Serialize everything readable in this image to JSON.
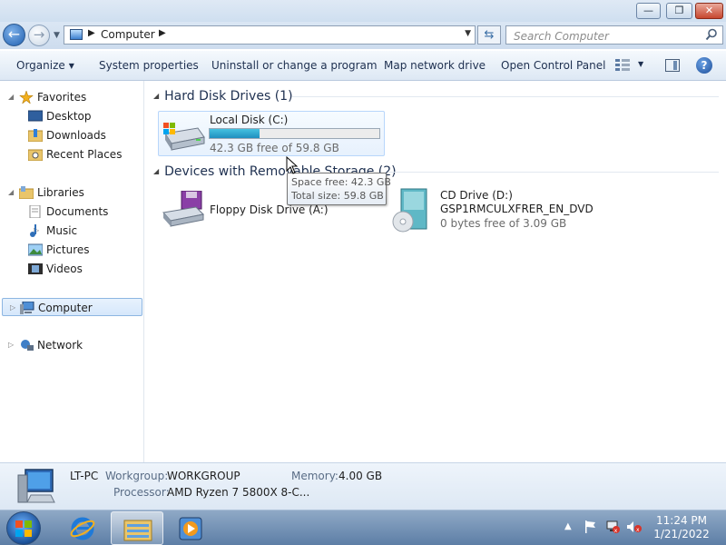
{
  "window": {
    "controls": {
      "minimize_glyph": "—",
      "maximize_glyph": "❐",
      "close_glyph": "✕"
    }
  },
  "address": {
    "path": "Computer",
    "search_placeholder": "Search Computer"
  },
  "commands": {
    "organize": "Organize",
    "system_properties": "System properties",
    "uninstall": "Uninstall or change a program",
    "map_network": "Map network drive",
    "open_control_panel": "Open Control Panel"
  },
  "sidebar": {
    "favorites": "Favorites",
    "desktop": "Desktop",
    "downloads": "Downloads",
    "recent_places": "Recent Places",
    "libraries": "Libraries",
    "documents": "Documents",
    "music": "Music",
    "pictures": "Pictures",
    "videos": "Videos",
    "computer": "Computer",
    "network": "Network"
  },
  "content": {
    "hdd_group": "Hard Disk Drives (1)",
    "removable_group": "Devices with Removable Storage (2)",
    "local_disk": {
      "name": "Local Disk (C:)",
      "free_text": "42.3 GB free of 59.8 GB",
      "used_fraction": 0.293
    },
    "floppy": {
      "name": "Floppy Disk Drive (A:)"
    },
    "cd": {
      "name": "CD Drive (D:)",
      "label": "GSP1RMCULXFRER_EN_DVD",
      "free_text": "0 bytes free of 3.09 GB"
    },
    "tooltip": {
      "space_free": "Space free: 42.3 GB",
      "total_size": "Total size: 59.8 GB"
    }
  },
  "details": {
    "pc_name": "LT-PC",
    "workgroup_label": "Workgroup:",
    "workgroup_value": "WORKGROUP",
    "memory_label": "Memory:",
    "memory_value": "4.00 GB",
    "processor_label": "Processor:",
    "processor_value": "AMD Ryzen 7 5800X 8-C..."
  },
  "taskbar": {
    "time": "11:24 PM",
    "date": "1/21/2022"
  }
}
